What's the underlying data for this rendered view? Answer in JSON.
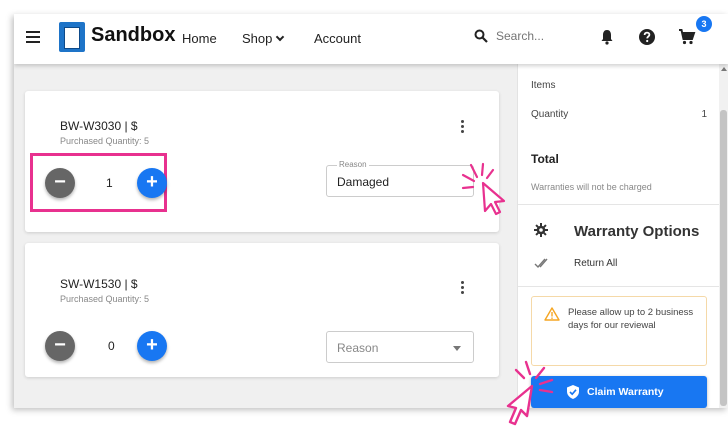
{
  "header": {
    "brand": "Sandbox",
    "nav": {
      "home": "Home",
      "shop": "Shop",
      "account": "Account"
    },
    "search_placeholder": "Search...",
    "cart_count": "3",
    "icons": [
      "menu-icon",
      "logo-icon",
      "search-icon",
      "bell-icon",
      "help-icon",
      "cart-icon"
    ]
  },
  "items": [
    {
      "sku": "BW-W3030 | $",
      "purchased": "Purchased Quantity: 5",
      "quantity": "1",
      "reason_label": "Reason",
      "reason_value": "Damaged"
    },
    {
      "sku": "SW-W1530 | $",
      "purchased": "Purchased Quantity: 5",
      "quantity": "0",
      "reason_placeholder": "Reason"
    }
  ],
  "summary": {
    "items_label": "Items",
    "quantity_label": "Quantity",
    "quantity_value": "1",
    "total_label": "Total",
    "note": "Warranties will not be charged",
    "options_title": "Warranty Options",
    "return_all": "Return All",
    "alert": "Please allow up to 2 business days for our reviewal",
    "claim_button": "Claim Warranty"
  },
  "colors": {
    "primary": "#1877f2",
    "highlight": "#e8318f",
    "alert_border": "#f5d9a8",
    "alert_icon": "#f5a623"
  }
}
